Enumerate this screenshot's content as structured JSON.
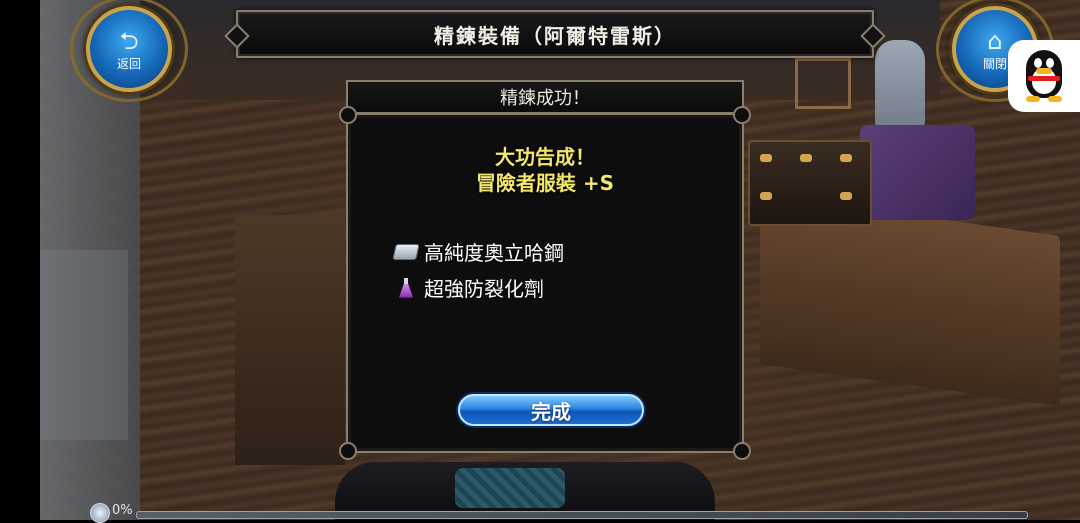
{
  "header": {
    "title": "精鍊裝備（阿爾特雷斯）",
    "back_button": {
      "label": "返回",
      "icon": "back-arrow-icon"
    },
    "close_button": {
      "label": "關閉",
      "icon": "home-icon"
    }
  },
  "dialog": {
    "title": "精鍊成功！",
    "result_line1": "大功告成！",
    "result_line2": "冒險者服裝 +S",
    "materials": [
      {
        "name": "高純度奧立哈鋼",
        "icon": "metal-ingot-icon"
      },
      {
        "name": "超強防裂化劑",
        "icon": "potion-flask-icon"
      }
    ],
    "confirm_label": "完成"
  },
  "progress": {
    "percent_label": "0%",
    "value": 0
  },
  "overlay": {
    "app_icon": "qq-penguin-icon"
  },
  "colors": {
    "accent_gold": "#c9a44e",
    "button_blue": "#1568b8",
    "success_yellow": "#f4e66a",
    "frame_border": "#8a7f6e"
  }
}
